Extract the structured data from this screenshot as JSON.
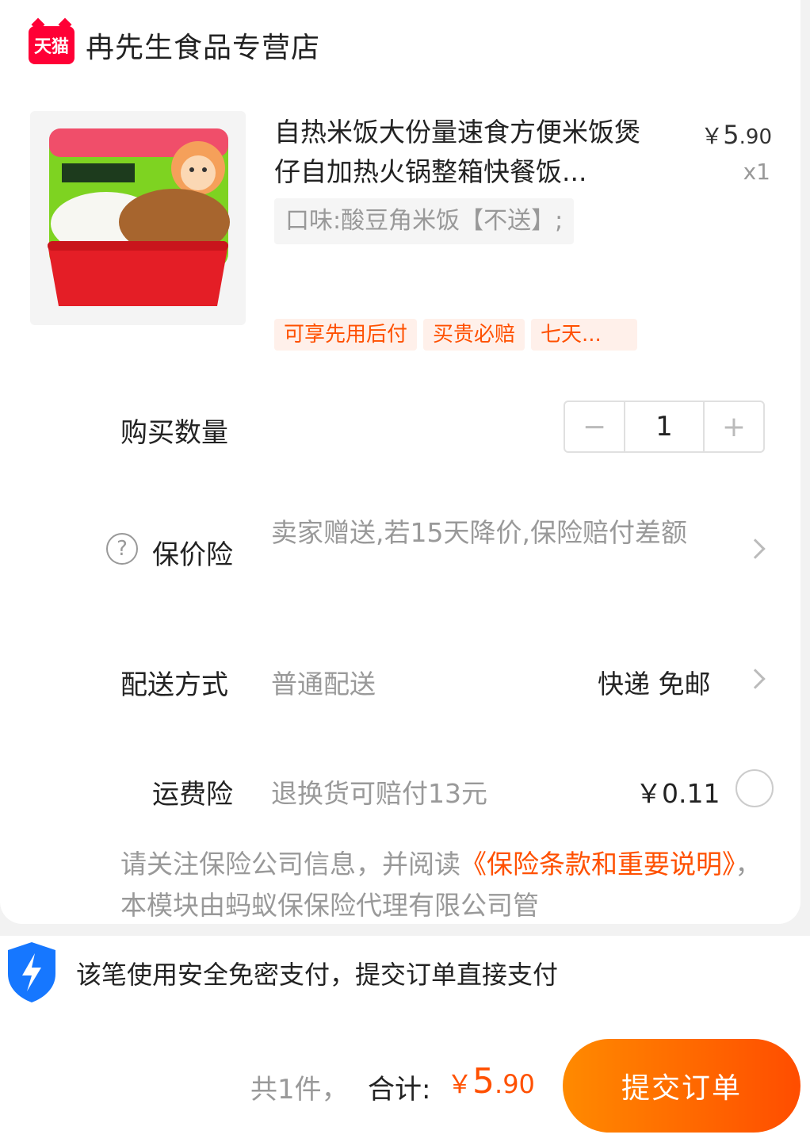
{
  "store": {
    "badge": "天猫",
    "name": "冉先生食品专营店"
  },
  "product": {
    "title": "自热米饭大份量速食方便米饭煲仔自加热火锅整箱快餐饭...",
    "price_symbol": "￥",
    "price_int": "5",
    "price_dec": ".90",
    "quantity_label": "x1",
    "sku": "口味:酸豆角米饭【不送】;",
    "tags": [
      "可享先用后付",
      "买贵必赔",
      "七天..."
    ]
  },
  "quantity": {
    "label": "购买数量",
    "minus": "−",
    "value": "1",
    "plus": "+"
  },
  "price_insurance": {
    "icon": "question-circle-icon",
    "label": "保价险",
    "value": "卖家赠送,若15天降价,保险赔付差额"
  },
  "delivery": {
    "label": "配送方式",
    "value": "普通配送",
    "right": "快递 免邮"
  },
  "shipping_insurance": {
    "label": "运费险",
    "value": "退换货可赔付13元",
    "price": "￥0.11"
  },
  "notice": {
    "before": "请关注保险公司信息，并阅读",
    "link": "《保险条款和重要说明》",
    "after": "，本模块由蚂蚁保保险代理有限公司管"
  },
  "secure": {
    "icon": "shield-lightning-icon",
    "text": "该笔使用安全免密支付，提交订单直接支付"
  },
  "footer": {
    "count": "共1件，",
    "total_label": "合计:",
    "total_symbol": "￥",
    "total_int": "5",
    "total_dec": ".90",
    "submit": "提交订单"
  },
  "colors": {
    "accent": "#ff5000",
    "tmall_red": "#ff0036",
    "shield_blue": "#1677ff"
  }
}
